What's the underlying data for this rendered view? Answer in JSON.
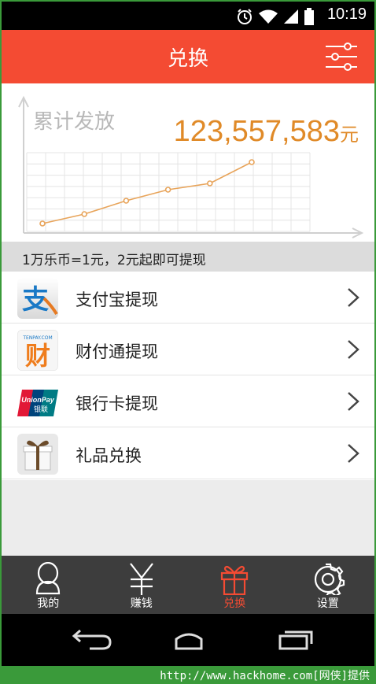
{
  "status_bar": {
    "time": "10:19",
    "icons": [
      "alarm-icon",
      "wifi-icon",
      "signal-icon",
      "battery-icon"
    ]
  },
  "header": {
    "title": "兑换",
    "filter_icon": "sliders-icon"
  },
  "summary": {
    "label": "累计发放",
    "total": "123,557,583",
    "unit": "元"
  },
  "chart_data": {
    "type": "line",
    "x": [
      1,
      2,
      3,
      4,
      5,
      6
    ],
    "values": [
      0.08,
      0.2,
      0.37,
      0.51,
      0.59,
      0.86
    ],
    "color": "#e8a45a",
    "grid": true
  },
  "info": {
    "text": "1万乐币=1元，2元起即可提现"
  },
  "list": {
    "items": [
      {
        "label": "支付宝提现",
        "icon": "alipay-icon"
      },
      {
        "label": "财付通提现",
        "icon": "tenpay-icon"
      },
      {
        "label": "银行卡提现",
        "icon": "unionpay-icon"
      },
      {
        "label": "礼品兑换",
        "icon": "gift-box-icon"
      }
    ]
  },
  "tabs": [
    {
      "label": "我的",
      "icon": "user-icon"
    },
    {
      "label": "赚钱",
      "icon": "yen-icon"
    },
    {
      "label": "兑换",
      "icon": "gift-icon",
      "active": true
    },
    {
      "label": "设置",
      "icon": "gear-icon"
    }
  ],
  "icon_text": {
    "alipay": "支",
    "tenpay": "财",
    "tenpay_small": "TENPAY.COM",
    "unionpay": "UnionPay",
    "unionpay_cn": "银联"
  },
  "watermark": "http://www.hackhome.com[网侠]提供",
  "colors": {
    "accent": "#f44b33",
    "total_value": "#e08a28",
    "tab_bar": "#3d3d3d"
  }
}
